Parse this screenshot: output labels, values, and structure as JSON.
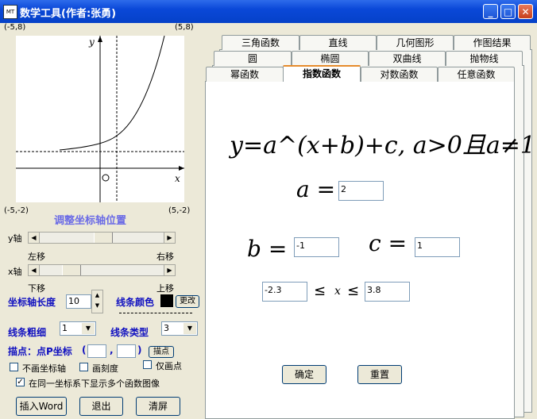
{
  "window": {
    "title": "数学工具(作者:张勇)",
    "icon_text": "MT",
    "min_glyph": "_",
    "max_glyph": "□",
    "close_glyph": "✕"
  },
  "plot": {
    "top_left": "(-5,8)",
    "top_right": "(5,8)",
    "bottom_left": "(-5,-2)",
    "bottom_right": "(5,-2)",
    "x_label": "x",
    "y_label": "y",
    "origin_label": "O"
  },
  "controls": {
    "axis_adjust_title": "调整坐标轴位置",
    "y_axis_label": "y轴",
    "left_move": "左移",
    "right_move": "右移",
    "x_axis_label": "x轴",
    "down_move": "下移",
    "up_move": "上移",
    "axis_length_label": "坐标轴长度",
    "axis_length_value": "10",
    "line_color_label": "线条颜色",
    "change_button": "更改",
    "line_width_label": "线条粗细",
    "line_width_value": "1",
    "line_type_label": "线条类型",
    "line_type_value": "3",
    "point_label": "描点：点P坐标",
    "point_open": "(",
    "point_comma": ",",
    "point_close": ")",
    "point_button": "描点",
    "no_axis_label": "不画坐标轴",
    "draw_ticks_label": "画刻度",
    "only_point_label": "仅画点",
    "multi_graph_label": "在同一坐标系下显示多个函数图像",
    "insert_word": "插入Word",
    "exit": "退出",
    "clear": "清屏"
  },
  "tabs": {
    "row1": [
      "三角函数",
      "直线",
      "几何图形",
      "作图结果"
    ],
    "row2": [
      "圆",
      "椭圆",
      "双曲线",
      "抛物线"
    ],
    "row3": [
      "幂函数",
      "指数函数",
      "对数函数",
      "任意函数"
    ]
  },
  "exp_panel": {
    "formula": "y=a^(x+b)+c,  a>0且a≠1",
    "a_label": "a =",
    "a_value": "2",
    "b_label": "b =",
    "b_value": "-1",
    "c_label": "c =",
    "c_value": "1",
    "x_min": "-2.3",
    "x_max": "3.8",
    "x_var": "x",
    "le_symbol": "≤",
    "confirm": "确定",
    "reset": "重置"
  },
  "colors": {
    "line_color": "#000000",
    "titlebar": "#0A48D8"
  }
}
